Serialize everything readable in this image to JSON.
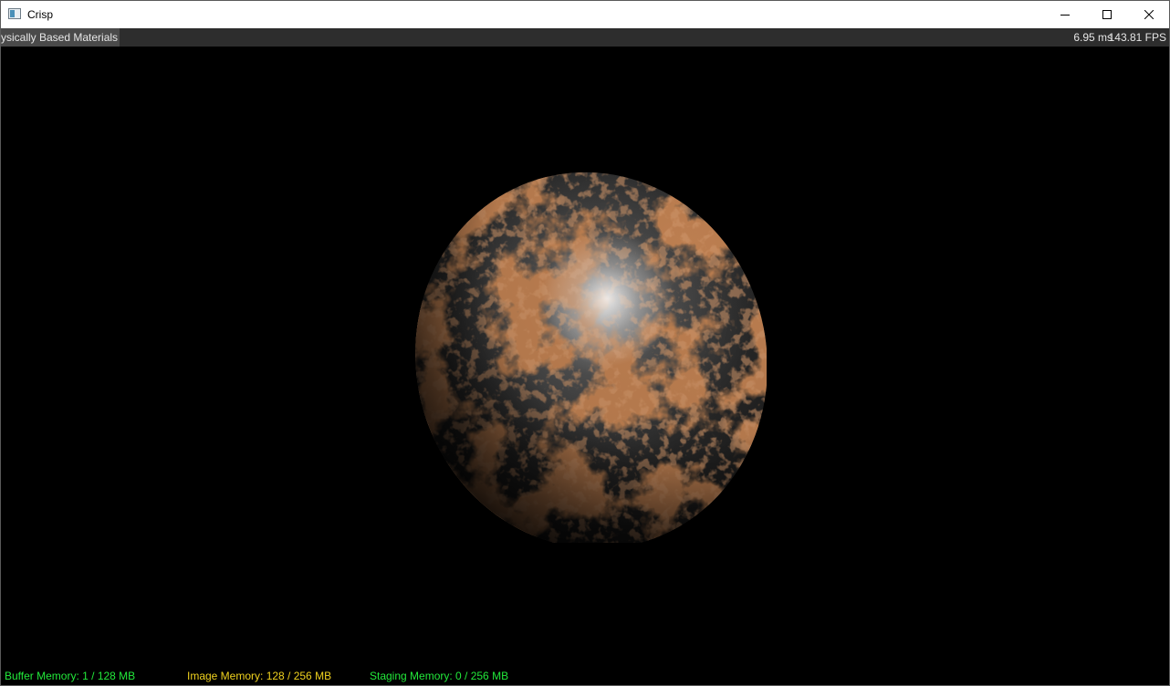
{
  "window": {
    "title": "Crisp",
    "icon": "app-window-icon"
  },
  "controls": {
    "minimize_icon": "minimize-icon",
    "maximize_icon": "maximize-icon",
    "close_icon": "close-icon"
  },
  "overlay": {
    "scene_name": "ysically Based Materials",
    "frame_time": "6.95 ms",
    "fps": "143.81 FPS"
  },
  "memory": {
    "buffer": {
      "text": "Buffer Memory: 1 / 128 MB",
      "color": "#22e83a"
    },
    "image": {
      "text": "Image Memory: 128 / 256 MB",
      "color": "#f0d21e"
    },
    "staging": {
      "text": "Staging Memory: 0 / 256 MB",
      "color": "#22e83a"
    }
  },
  "colors": {
    "background": "#000000",
    "overlay_bar": "#2d2d2d",
    "rust": "#7a3414",
    "metal": "#8a8a8a"
  }
}
